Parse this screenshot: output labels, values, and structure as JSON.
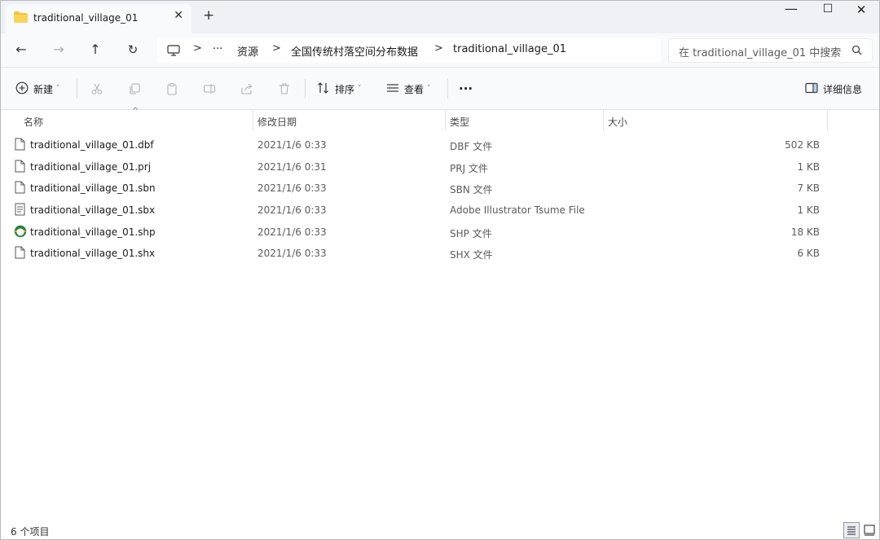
{
  "tab": {
    "title": "traditional_village_01",
    "close_glyph": "✕",
    "new_tab_glyph": "+"
  },
  "window_controls": {
    "minimize": "—",
    "maximize": "☐",
    "close": "✕"
  },
  "nav": {
    "back": "←",
    "forward": "→",
    "up": "↑",
    "refresh": "↻"
  },
  "address": {
    "more": "···",
    "crumbs": [
      "资源",
      "全国传统村落空间分布数据",
      "traditional_village_01"
    ],
    "separator": ">"
  },
  "search": {
    "placeholder": "在 traditional_village_01 中搜索"
  },
  "toolbar": {
    "new_label": "新建",
    "sort_label": "排序",
    "view_label": "查看",
    "more_label": "···",
    "details_label": "详细信息"
  },
  "columns": {
    "name": "名称",
    "modified": "修改日期",
    "type": "类型",
    "size": "大小"
  },
  "files": [
    {
      "name": "traditional_village_01.dbf",
      "modified": "2021/1/6 0:33",
      "type": "DBF 文件",
      "size": "502 KB",
      "icon": "document-icon"
    },
    {
      "name": "traditional_village_01.prj",
      "modified": "2021/1/6 0:31",
      "type": "PRJ 文件",
      "size": "1 KB",
      "icon": "document-icon"
    },
    {
      "name": "traditional_village_01.sbn",
      "modified": "2021/1/6 0:33",
      "type": "SBN 文件",
      "size": "7 KB",
      "icon": "document-icon"
    },
    {
      "name": "traditional_village_01.sbx",
      "modified": "2021/1/6 0:33",
      "type": "Adobe Illustrator Tsume File",
      "size": "1 KB",
      "icon": "illustrator-file-icon"
    },
    {
      "name": "traditional_village_01.shp",
      "modified": "2021/1/6 0:33",
      "type": "SHP 文件",
      "size": "18 KB",
      "icon": "arcgis-globe-icon"
    },
    {
      "name": "traditional_village_01.shx",
      "modified": "2021/1/6 0:33",
      "type": "SHX 文件",
      "size": "6 KB",
      "icon": "document-icon"
    }
  ],
  "status": {
    "item_count": "6 个项目"
  },
  "colors": {
    "titlebar_bg": "#eef1f6",
    "toolbar_bg": "#f9fafc",
    "folder_yellow": "#f4c542"
  }
}
